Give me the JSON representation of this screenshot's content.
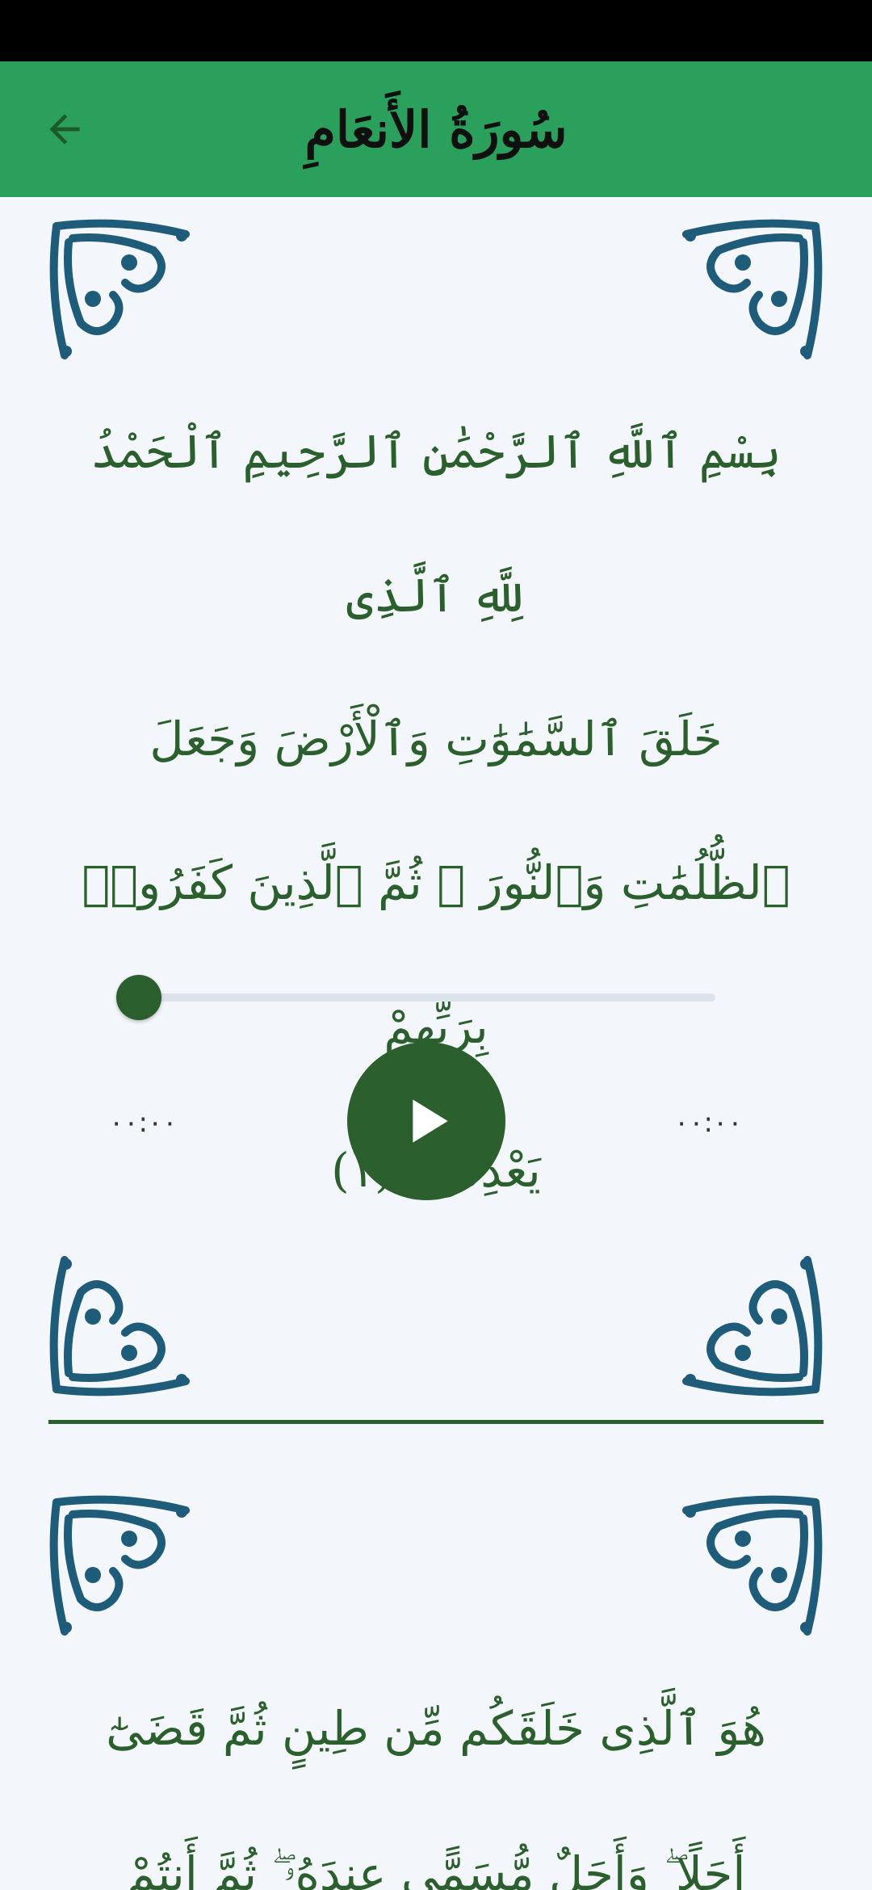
{
  "app_bar": {
    "title": "سُورَةُ الأَنعَامِ",
    "back_icon": "arrow-left-icon",
    "background": "#2aa05c"
  },
  "colors": {
    "verse_text": "#2c5f2e",
    "ornament": "#1f5c7a",
    "page_bg": "#f3f6fa"
  },
  "verses": [
    {
      "lines": [
        "بِسْمِ ٱللَّهِ ٱلرَّحْمَٰنِ ٱلرَّحِيمِ ٱلْحَمْدُ لِلَّهِ ٱلَّذِى",
        "خَلَقَ ٱلسَّمَٰوَٰتِ وَٱلْأَرْضَ وَجَعَلَ",
        "ٱلظُّلُمَٰتِ وَٱلنُّورَ ۖ ثُمَّ ٱلَّذِينَ كَفَرُوا۟ بِرَبِّهِمْ",
        "يَعْدِلُونَ (١)"
      ],
      "player": {
        "progress": 0.0,
        "time_elapsed": "٠٠:٠٠",
        "time_total": "٠٠:٠٠",
        "play_icon": "play-icon"
      }
    },
    {
      "lines": [
        "هُوَ ٱلَّذِى خَلَقَكُم مِّن طِينٍ ثُمَّ قَضَىٰٓ",
        "أَجَلًا ۖ وَأَجَلٌ مُّسَمًّى عِندَهُۥ ۖ ثُمَّ أَنتُمْ"
      ]
    }
  ]
}
